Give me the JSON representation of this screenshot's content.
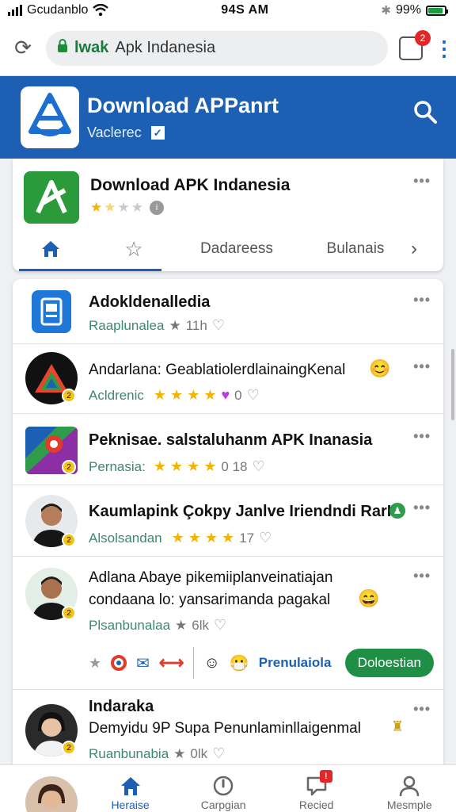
{
  "status": {
    "carrier": "Gcudanblo",
    "time": "94S AM",
    "battery": "99%",
    "battery_level": 0.9
  },
  "browser": {
    "url_host": "lwak",
    "url_rest": "Apk Indanesia",
    "tab_count": "2"
  },
  "hero": {
    "title": "Download APPanrt",
    "subtitle": "Vaclerec",
    "check": "✓"
  },
  "app": {
    "title": "Download APK Indanesia",
    "rating": 2,
    "max_rating": 5
  },
  "nav_tabs": [
    {
      "label": "Dadareess"
    },
    {
      "label": "Bulanais"
    }
  ],
  "items": [
    {
      "title": "Adokldenalledia",
      "meta": "Raaplunalea",
      "meta2": "11h"
    },
    {
      "title": "Andarlana: GeablatiolerdlainaingKenal",
      "meta": "Acldrenic",
      "meta2": "0"
    },
    {
      "title": "Peknisae. salstaluhanm APK Inanasia",
      "meta": "Pernasia:",
      "meta2": "0 18"
    },
    {
      "title": "Kaumlapink Çokpy Janlve Iriendndi RarK",
      "meta": "Alsolsandan",
      "meta2": "17"
    },
    {
      "title_1": "Adlana Abaye pikemiiplanveinatiajan",
      "title_2": "condaana lo: yansarimanda pagakal",
      "meta": "Plsanbunalaa",
      "meta2": "6lk"
    },
    {
      "title": "Indaraka",
      "subtitle": "Demyidu 9P Supa Penunlaminllaigenmal",
      "meta": "Ruanbunabia",
      "meta2": "0lk"
    }
  ],
  "actions": {
    "link": "Prenulaiola",
    "download": "Doloestian"
  },
  "bottom_nav": [
    {
      "label": "Heraise"
    },
    {
      "label": "Carpgian"
    },
    {
      "label": "Recied",
      "badge": "!"
    },
    {
      "label": "Mesmple"
    }
  ],
  "colors": {
    "primary": "#1c5fb3",
    "green": "#1f8f46",
    "star": "#f2b400"
  }
}
